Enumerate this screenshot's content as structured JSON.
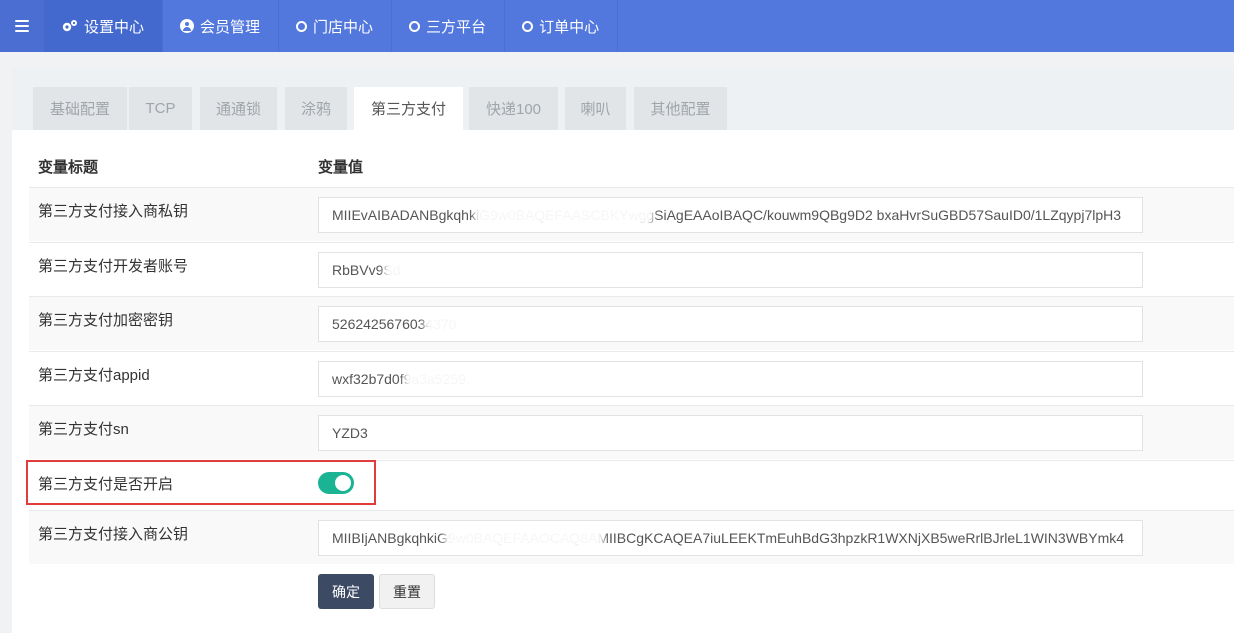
{
  "nav": {
    "items": [
      {
        "label": "设置中心",
        "icon": "gears-icon"
      },
      {
        "label": "会员管理",
        "icon": "user-circle-icon"
      },
      {
        "label": "门店中心",
        "icon": "circle-icon"
      },
      {
        "label": "三方平台",
        "icon": "circle-icon"
      },
      {
        "label": "订单中心",
        "icon": "circle-icon"
      }
    ]
  },
  "tabs": [
    "基础配置",
    "TCP",
    "通通锁",
    "涂鸦",
    "第三方支付",
    "快递100",
    "喇叭",
    "其他配置"
  ],
  "active_tab": "第三方支付",
  "table": {
    "header_label": "变量标题",
    "header_value": "变量值",
    "rows": [
      {
        "label": "第三方支付接入商私钥",
        "value": "MIIEvAIBADANBgkqhkiG9w0BAQEFAASCBKYwggSiAgEAAoIBAQC/kouwm9QBg9D2 bxaHvrSuGBD57SauID0/1LZqypj7lpH3"
      },
      {
        "label": "第三方支付开发者账号",
        "value": "RbBVv9Sd"
      },
      {
        "label": "第三方支付加密密钥",
        "value": "5262425676034370"
      },
      {
        "label": "第三方支付appid",
        "value": "wxf32b7d0f9a3a5259"
      },
      {
        "label": "第三方支付sn",
        "value": "YZD3"
      },
      {
        "label": "第三方支付是否开启",
        "toggle": true
      },
      {
        "label": "第三方支付接入商公钥",
        "value": "MIIBIjANBgkqhkiG9w0BAQEFAAOCAQ8AMIIBCgKCAQEA7iuLEEKTmEuhBdG3hpzkR1WXNjXB5weRrlBJrleL1WIN3WBYmk4"
      }
    ]
  },
  "buttons": {
    "confirm": "确定",
    "reset": "重置"
  },
  "colors": {
    "nav_bg": "#5277dd",
    "toggle_on": "#1ab394",
    "highlight": "#e03c3c",
    "confirm_bg": "#3c4a63"
  }
}
